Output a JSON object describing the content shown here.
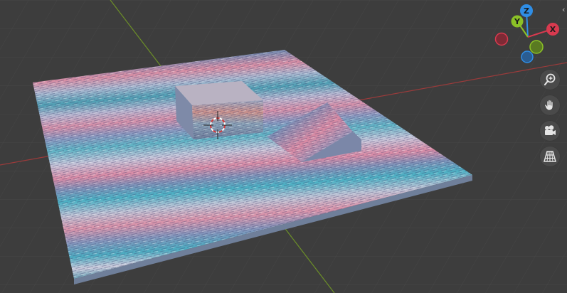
{
  "viewport": {
    "background": "#3d3d3d",
    "grid_color": "#464646",
    "axis_x_color": "#9a3b3b",
    "axis_y_color": "#6c8f28"
  },
  "gizmo": {
    "z_label": "Z",
    "y_label": "Y",
    "x_label": "X",
    "colors": {
      "x": "#d83a4f",
      "y": "#8bc127",
      "z": "#2f8ee6",
      "neg_x": "#7e2a35",
      "neg_y": "#5a7a22",
      "neg_z": "#2a5d92"
    }
  },
  "navigation": {
    "zoom_icon": "zoom-in-icon",
    "pan_icon": "hand-pan-icon",
    "camera_icon": "camera-view-icon",
    "projection_icon": "perspective-grid-icon"
  },
  "edge_tab": "‹"
}
